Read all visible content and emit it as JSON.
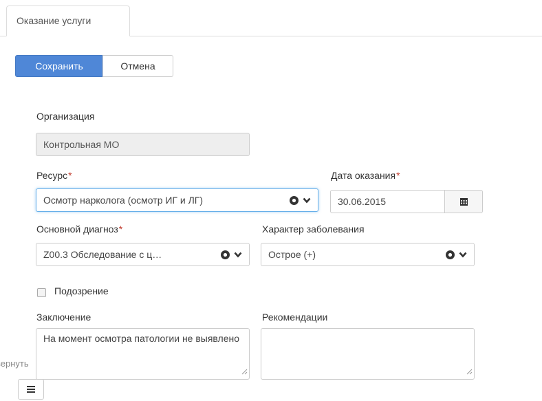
{
  "tabs": [
    {
      "label": "Оказание услуги"
    }
  ],
  "toolbar": {
    "save_label": "Сохранить",
    "cancel_label": "Отмена"
  },
  "form": {
    "organization": {
      "label": "Организация",
      "value": "Контрольная МО"
    },
    "resource": {
      "label": "Ресурс",
      "required_mark": "*",
      "value": "Осмотр нарколога (осмотр ИГ и ЛГ)",
      "icons": [
        "clear-circle-icon",
        "chevron-down-icon"
      ]
    },
    "date": {
      "label": "Дата оказания",
      "required_mark": "*",
      "value": "30.06.2015",
      "icon": "calendar-icon"
    },
    "diagnosis": {
      "label": "Основной диагноз",
      "required_mark": "*",
      "value": "Z00.3 Обследование с ц…",
      "icons": [
        "clear-circle-icon",
        "chevron-down-icon"
      ]
    },
    "disease_character": {
      "label": "Характер заболевания",
      "value": "Острое (+)",
      "icons": [
        "clear-circle-icon",
        "chevron-down-icon"
      ]
    },
    "suspicion": {
      "label": "Подозрение",
      "checked": false
    },
    "conclusion": {
      "label": "Заключение",
      "value": "На момент осмотра патологии не выявлено"
    },
    "recommendations": {
      "label": "Рекомендации",
      "value": ""
    }
  },
  "side_tag": {
    "label": "вернуть"
  },
  "menu_button": {
    "icon": "menu-icon"
  },
  "colors": {
    "primary": "#4f87d7",
    "required": "#c0392b",
    "focus_border": "#66afe9",
    "border": "#cccccc"
  }
}
